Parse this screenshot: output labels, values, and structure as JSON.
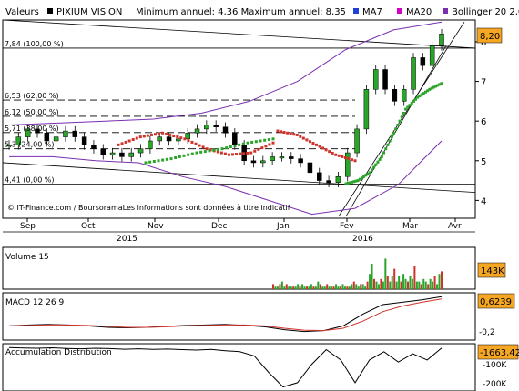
{
  "header": {
    "valeurs_label": "Valeurs",
    "stock_name": "PIXIUM VISION",
    "min_max": "Minimum annuel: 4,36 Maximum annuel: 8,35",
    "legend": [
      {
        "label": "MA7",
        "color": "#1f3fd6"
      },
      {
        "label": "MA20",
        "color": "#d400c8"
      },
      {
        "label": "Bollinger 20 2,0",
        "color": "#7a2fb0"
      }
    ]
  },
  "price_panel": {
    "current_value": "8,20",
    "y_ticks": [
      "8",
      "7",
      "6",
      "5",
      "4"
    ],
    "levels": [
      {
        "label": "7,84 (100,00 %)",
        "value": 7.84
      },
      {
        "label": "6,53 (62,00 %)",
        "value": 6.53
      },
      {
        "label": "6,12 (50,00 %)",
        "value": 6.12
      },
      {
        "label": "5,71 (38,00 %)",
        "value": 5.71
      },
      {
        "label": "5,3 (24,00 %)",
        "value": 5.3
      },
      {
        "label": "4,41 (0,00 %)",
        "value": 4.41
      }
    ],
    "copyright": "© IT-Finance.com / BoursoramaLes informations sont données à titre indicatif",
    "x_months": [
      "Sep",
      "Oct",
      "Nov",
      "Dec",
      "Jan",
      "Fev",
      "Mar",
      "Avr"
    ],
    "years": [
      "2015",
      "2016"
    ]
  },
  "volume_panel": {
    "title": "Volume 15",
    "value_label": "143K"
  },
  "macd_panel": {
    "title": "MACD 12 26 9",
    "value_label": "0,6239",
    "tick": "-0,2"
  },
  "ad_panel": {
    "title": "Accumulation Distribution",
    "value_label": "-1663,42",
    "ticks": [
      "-100K",
      "-200K"
    ]
  },
  "chart_data": [
    {
      "type": "candlestick",
      "title": "PIXIUM VISION",
      "x": [
        "Sep",
        "Oct",
        "Nov",
        "Dec",
        "Jan",
        "Fev",
        "Mar",
        "Avr"
      ],
      "ylim": [
        3.55,
        8.55
      ],
      "close_series_approx": [
        5.4,
        5.6,
        5.8,
        5.7,
        5.5,
        5.6,
        5.75,
        5.6,
        5.4,
        5.3,
        5.15,
        5.2,
        5.1,
        5.2,
        5.3,
        5.5,
        5.6,
        5.5,
        5.55,
        5.7,
        5.8,
        5.9,
        5.85,
        5.7,
        5.4,
        5.0,
        4.95,
        5.0,
        5.1,
        5.1,
        5.05,
        4.95,
        4.7,
        4.5,
        4.45,
        4.6,
        5.2,
        5.8,
        6.8,
        7.3,
        6.8,
        6.5,
        6.8,
        7.6,
        7.4,
        7.9,
        8.2
      ],
      "ma7": [
        4.42,
        4.5,
        4.7,
        5.1,
        5.7,
        6.3,
        6.6,
        6.8,
        6.95
      ],
      "ma20": [
        4.45,
        4.55,
        4.8,
        5.2,
        5.6,
        6.0,
        6.4,
        6.7,
        6.85
      ],
      "bollinger_upper": [
        5.9,
        5.95,
        6.0,
        6.05,
        6.2,
        6.5,
        7.0,
        7.8,
        8.3,
        8.5
      ],
      "bollinger_lower": [
        5.1,
        5.1,
        5.0,
        4.95,
        4.6,
        4.35,
        4.0,
        3.65,
        3.8,
        4.4,
        5.5
      ]
    },
    {
      "type": "bar",
      "title": "Volume 15",
      "values": [
        2,
        1,
        1,
        2,
        3,
        1,
        2,
        1,
        1,
        1,
        1,
        2,
        1,
        2,
        1,
        1,
        1,
        2,
        1,
        1,
        3,
        2,
        1,
        1,
        2,
        1,
        1,
        1,
        2,
        1,
        1,
        2,
        1,
        1,
        1,
        2,
        3,
        2,
        1,
        2,
        2,
        1,
        3,
        6,
        10,
        4,
        3,
        2,
        4,
        3,
        12,
        5,
        3,
        5,
        8,
        3,
        5,
        3,
        6,
        4,
        3,
        5,
        4,
        9,
        3,
        3,
        2,
        4,
        3,
        2,
        4,
        3,
        5,
        2,
        6,
        7
      ],
      "ylim": [
        0,
        15
      ]
    },
    {
      "type": "line",
      "title": "MACD 12 26 9",
      "series": [
        {
          "values": [
            0.0,
            0.02,
            0.03,
            0.02,
            0.0,
            -0.03,
            -0.04,
            -0.03,
            -0.01,
            0.01,
            0.02,
            0.03,
            0.01,
            -0.02,
            -0.08,
            -0.12,
            -0.1,
            0.0,
            0.25,
            0.45,
            0.5,
            0.55,
            0.62
          ]
        },
        {
          "values": [
            0.0,
            0.01,
            0.02,
            0.02,
            0.01,
            -0.01,
            -0.03,
            -0.03,
            -0.02,
            0.0,
            0.01,
            0.02,
            0.02,
            0.0,
            -0.05,
            -0.09,
            -0.1,
            -0.05,
            0.1,
            0.3,
            0.42,
            0.5,
            0.57
          ]
        }
      ],
      "ylim": [
        -0.3,
        0.7
      ]
    },
    {
      "type": "line",
      "title": "Accumulation Distribution",
      "values": [
        0,
        -2000,
        -3000,
        -1000,
        -4000,
        -6000,
        -3000,
        -5000,
        -8000,
        -6000,
        -9000,
        -7000,
        -10000,
        -12000,
        -9000,
        -15000,
        -20000,
        -40000,
        -120000,
        -190000,
        -170000,
        -80000,
        -10000,
        -60000,
        -170000,
        -60000,
        -20000,
        -70000,
        -30000,
        -60000,
        -2000
      ],
      "ylim": [
        -210000,
        10000
      ]
    }
  ]
}
